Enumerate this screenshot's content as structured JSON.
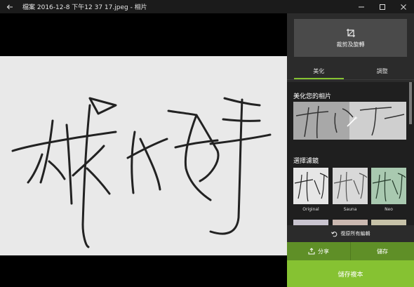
{
  "window": {
    "title": "檔案 2016-12-8 下午12 37 17.jpeg - 相片",
    "back_icon": "back-arrow-icon"
  },
  "panel": {
    "crop_label": "裁剪及旋轉",
    "tabs": [
      {
        "label": "美化",
        "active": true
      },
      {
        "label": "調整",
        "active": false
      }
    ],
    "enhance_title": "美化您的相片",
    "filters_title": "選擇濾鏡",
    "filters": [
      {
        "label": "Original"
      },
      {
        "label": "Sauna"
      },
      {
        "label": "Neo"
      }
    ],
    "undo_label": "復原所有編輯",
    "share_label": "分享",
    "save_label": "儲存",
    "save_copy_label": "儲存複本"
  },
  "colors": {
    "accent": "#86c232",
    "accent_dark": "#5f8f27"
  }
}
